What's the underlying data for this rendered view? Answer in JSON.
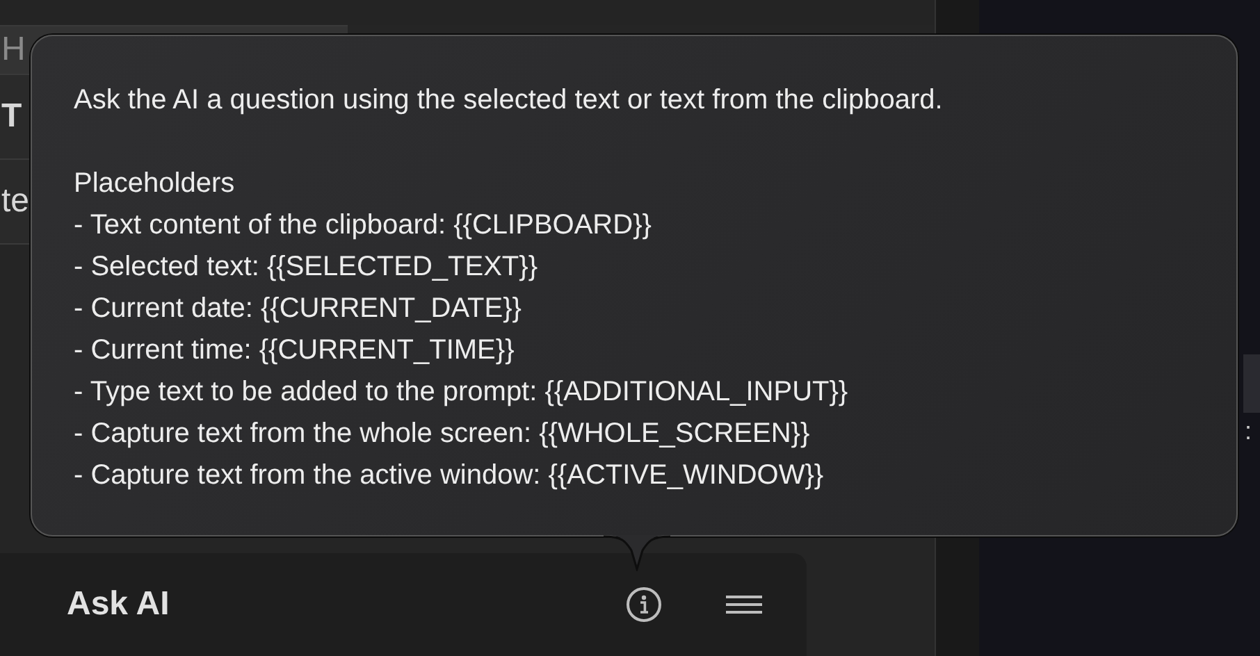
{
  "background_fields": [
    {
      "placeholder": "H"
    },
    {
      "value": "T"
    },
    {
      "value": "te"
    }
  ],
  "right_panel": {
    "fragment": ":"
  },
  "command_bar": {
    "title": "Ask AI"
  },
  "tooltip": {
    "description": "Ask the AI a question using the selected text or text from the clipboard.",
    "heading": "Placeholders",
    "lines": [
      "- Text content of the clipboard: {{CLIPBOARD}}",
      "- Selected text: {{SELECTED_TEXT}}",
      "- Current date: {{CURRENT_DATE}}",
      "- Current time: {{CURRENT_TIME}}",
      "- Type text to be added to the prompt: {{ADDITIONAL_INPUT}}",
      "- Capture text from the whole screen: {{WHOLE_SCREEN}}",
      "- Capture text from the active window: {{ACTIVE_WINDOW}}"
    ]
  }
}
